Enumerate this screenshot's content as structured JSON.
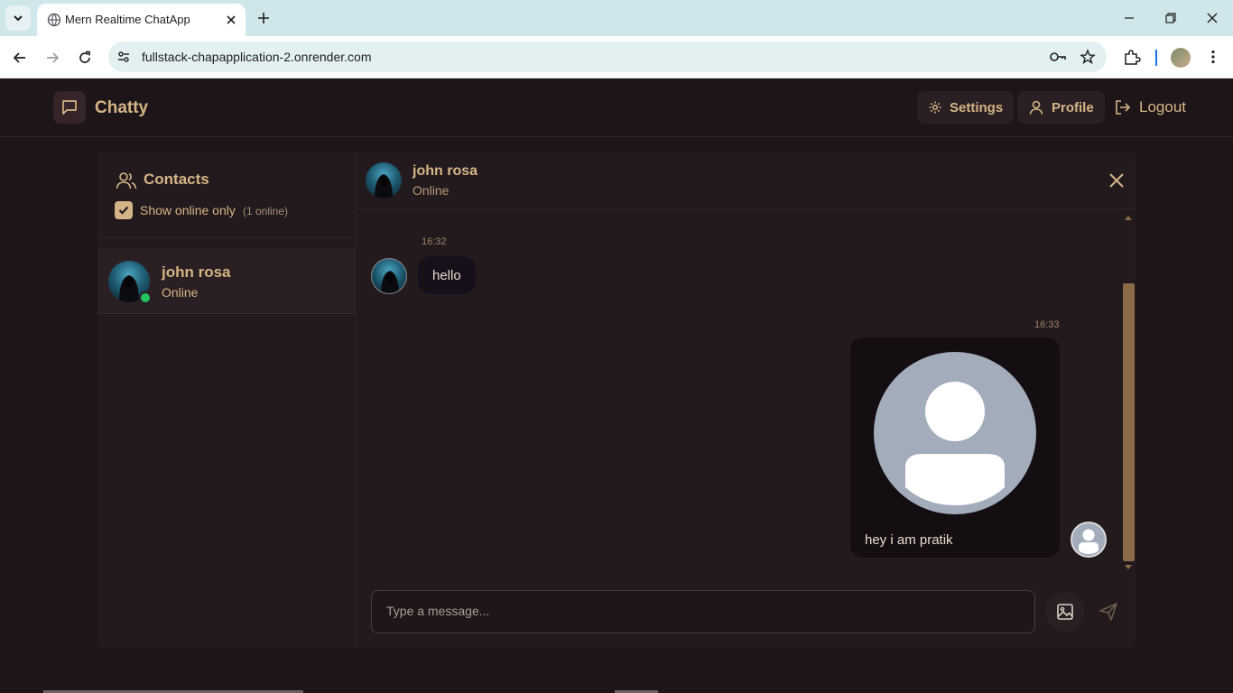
{
  "browser": {
    "tab_title": "Mern Realtime ChatApp",
    "url": "fullstack-chapapplication-2.onrender.com"
  },
  "header": {
    "brand": "Chatty",
    "settings_label": "Settings",
    "profile_label": "Profile",
    "logout_label": "Logout"
  },
  "sidebar": {
    "title": "Contacts",
    "filter_label": "Show online only",
    "online_count": "(1 online)",
    "filter_checked": true,
    "contacts": [
      {
        "name": "john rosa",
        "status": "Online"
      }
    ]
  },
  "chat": {
    "name": "john rosa",
    "status": "Online",
    "messages": [
      {
        "time": "16:32",
        "text": "hello",
        "direction": "incoming"
      },
      {
        "time": "16:33",
        "text": "hey i am pratik",
        "direction": "outgoing",
        "has_image": true
      }
    ],
    "input_placeholder": "Type a message..."
  },
  "colors": {
    "accent": "#d5b586",
    "background": "#1e1519",
    "online": "#22c55e"
  }
}
